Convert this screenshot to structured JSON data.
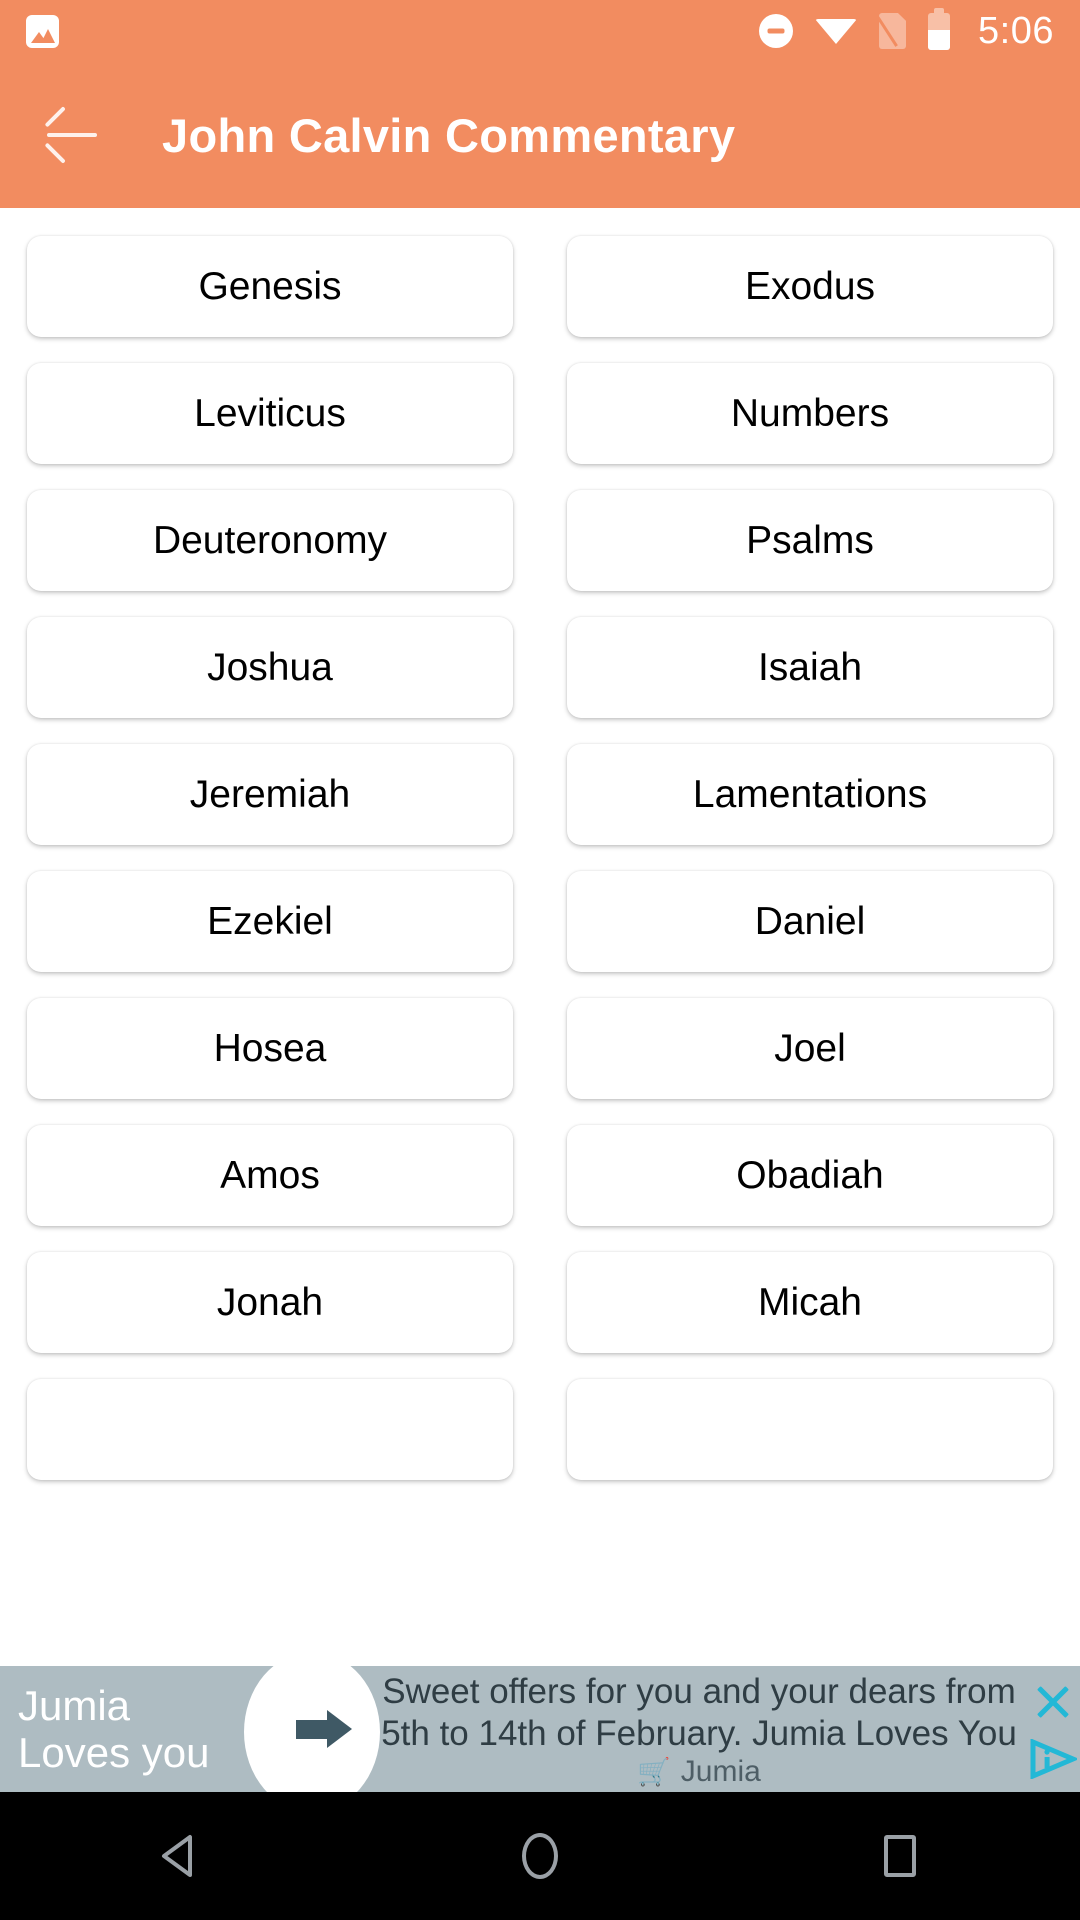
{
  "statusbar": {
    "time": "5:06",
    "icons": {
      "screenshot": "screenshot-icon",
      "dnd": "do-not-disturb-icon",
      "wifi": "wifi-icon",
      "nosim": "no-sim-icon",
      "battery": "battery-icon"
    }
  },
  "appbar": {
    "title": "John Calvin Commentary",
    "back_icon": "back-arrow-icon",
    "accent_color": "#F28C60"
  },
  "books": [
    "Genesis",
    "Exodus",
    "Leviticus",
    "Numbers",
    "Deuteronomy",
    "Psalms",
    "Joshua",
    "Isaiah",
    "Jeremiah",
    "Lamentations",
    "Ezekiel",
    "Daniel",
    "Hosea",
    "Joel",
    "Amos",
    "Obadiah",
    "Jonah",
    "Micah",
    "",
    ""
  ],
  "ad": {
    "brand_line_1": "Jumia",
    "brand_line_2": "Loves you",
    "copy_line_1": "Sweet offers for you and your dears from",
    "copy_line_2": "5th to 14th of February. Jumia Loves You",
    "cart_icon": "🛒",
    "advertiser": "Jumia",
    "close_icon": "close-icon",
    "adchoices_icon": "adchoices-icon",
    "background_color": "#AEBCC2",
    "accent_color": "#23B8D6"
  },
  "navbar": {
    "back_label": "back-icon",
    "home_label": "home-icon",
    "recents_label": "recents-icon"
  }
}
